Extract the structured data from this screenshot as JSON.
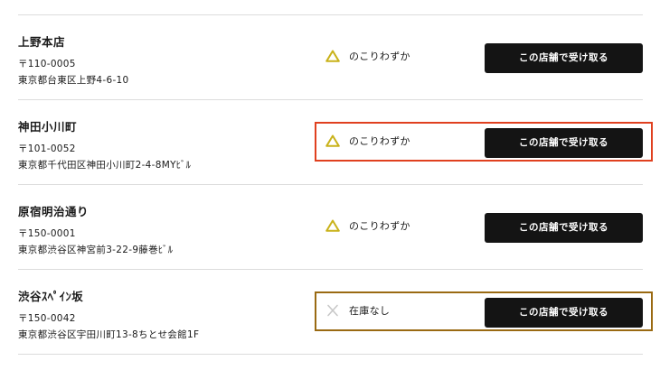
{
  "stores": [
    {
      "name": "上野本店",
      "postal": "〒110-0005",
      "address": "東京都台東区上野4-6-10",
      "stock_icon": "warning-triangle-icon",
      "stock_text": "のこりわずか",
      "button_label": "この店舗で受け取る"
    },
    {
      "name": "神田小川町",
      "postal": "〒101-0052",
      "address": "東京都千代田区神田小川町2-4-8MYﾋﾞﾙ",
      "stock_icon": "warning-triangle-icon",
      "stock_text": "のこりわずか",
      "button_label": "この店舗で受け取る"
    },
    {
      "name": "原宿明治通り",
      "postal": "〒150-0001",
      "address": "東京都渋谷区神宮前3-22-9藤巻ﾋﾞﾙ",
      "stock_icon": "warning-triangle-icon",
      "stock_text": "のこりわずか",
      "button_label": "この店舗で受け取る"
    },
    {
      "name": "渋谷ｽﾍﾟｲﾝ坂",
      "postal": "〒150-0042",
      "address": "東京都渋谷区宇田川町13-8ちとせ会館1F",
      "stock_icon": "cross-icon",
      "stock_text": "在庫なし",
      "button_label": "この店舗で受け取る"
    }
  ],
  "colors": {
    "button_bg": "#141414",
    "warning_icon": "#c9b21a",
    "out_of_stock_icon": "#c8c8c8",
    "highlight_red": "#e0401f",
    "highlight_brown": "#9a6a12"
  }
}
